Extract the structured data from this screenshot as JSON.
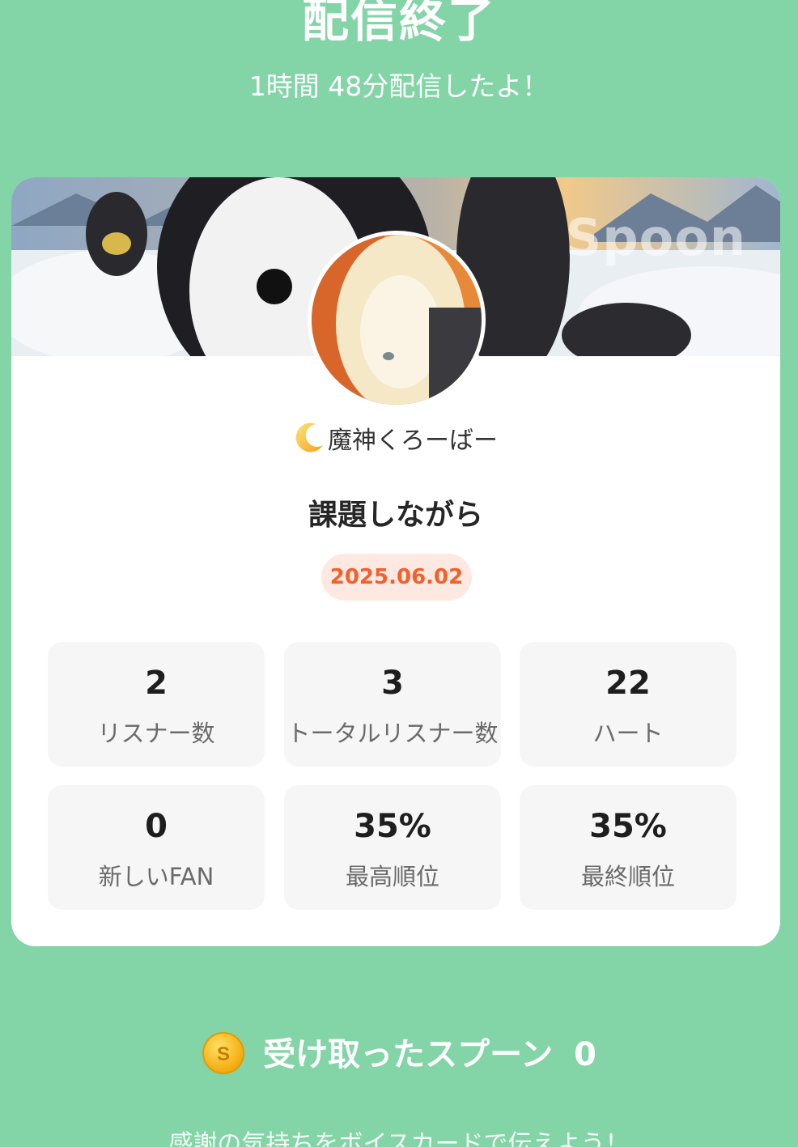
{
  "header": {
    "title": "配信終了",
    "duration_text": "1時間 48分配信したよ！"
  },
  "card": {
    "banner_watermark": "Spoon",
    "username": "魔神くろーばー",
    "live_title": "課題しながら",
    "date": "2025.06.02",
    "stats": [
      {
        "value": "2",
        "label": "リスナー数"
      },
      {
        "value": "3",
        "label": "トータルリスナー数"
      },
      {
        "value": "22",
        "label": "ハート"
      },
      {
        "value": "0",
        "label": "新しいFAN"
      },
      {
        "value": "35%",
        "label": "最高順位"
      },
      {
        "value": "35%",
        "label": "最終順位"
      }
    ]
  },
  "spoons": {
    "label": "受け取ったスプーン",
    "count": "0",
    "coin_symbol": "S"
  },
  "footer": {
    "voice_card_text": "感謝の気持ちをボイスカードで伝えよう！"
  },
  "colors": {
    "background": "#83d4a6",
    "date_text": "#f2602b",
    "date_bg": "#fde9e2",
    "coin": "#f5b400"
  }
}
